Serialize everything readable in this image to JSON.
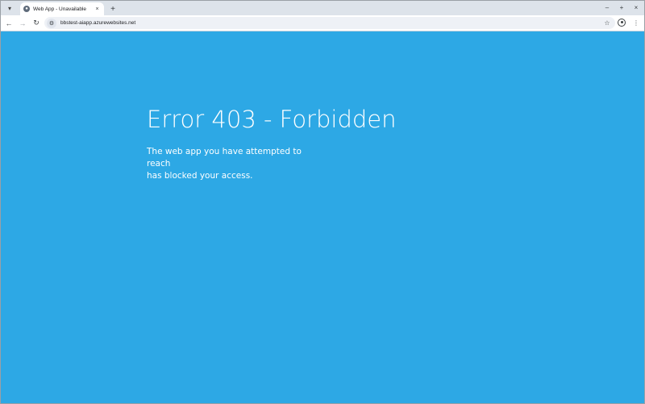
{
  "browser": {
    "tab": {
      "title": "Web App - Unavailable",
      "close_glyph": "×"
    },
    "new_tab_glyph": "+",
    "tab_list_glyph": "▾",
    "window_controls": {
      "minimize": "–",
      "maximize": "+",
      "close": "×"
    },
    "nav": {
      "back": "←",
      "forward": "→",
      "reload": "↻"
    },
    "omnibox": {
      "url": "bbstest-aiapp.azurewebsites.net",
      "site_info_glyph": "⚙",
      "star_glyph": "☆"
    },
    "menu_glyph": "⋮"
  },
  "page": {
    "title": "Error 403 - Forbidden",
    "message_line1": "The web app you have attempted to reach",
    "message_line2": "has blocked your access."
  },
  "colors": {
    "page_background": "#2da8e5",
    "text": "#ffffff",
    "chrome_background": "#dde3ea"
  }
}
